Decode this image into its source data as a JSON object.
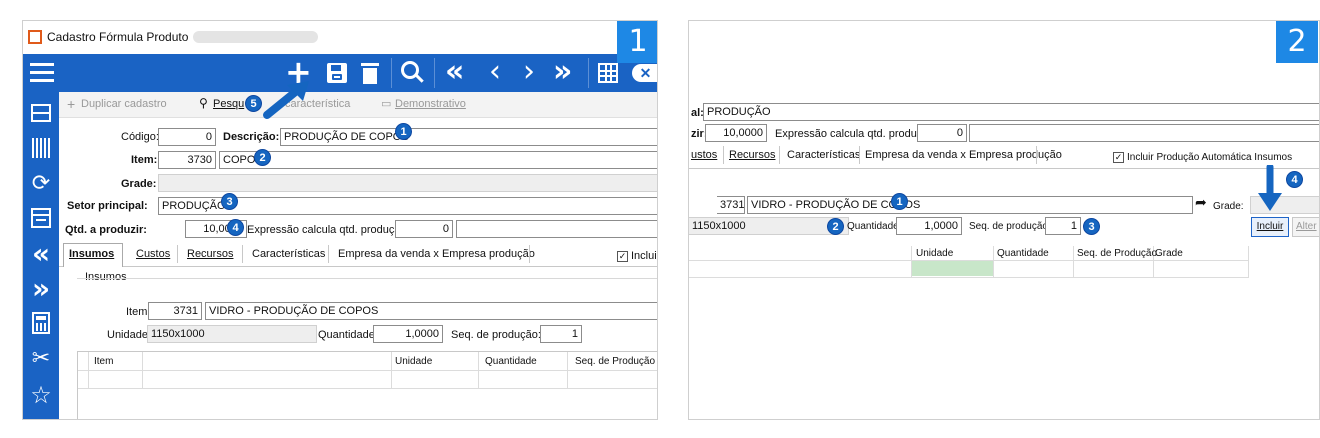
{
  "left": {
    "step": "1",
    "window_title": "Cadastro Fórmula Produto",
    "subtoolbar": {
      "duplicate": "Duplicar cadastro",
      "search": "Pesqu",
      "characteristic": "característica",
      "report": "Demonstrativo"
    },
    "form": {
      "codigo_label": "Código:",
      "codigo_value": "0",
      "descricao_label": "Descrição:",
      "descricao_value": "PRODUÇÃO DE COPOS",
      "item_label": "Item:",
      "item_code": "3730",
      "item_name": "COPO",
      "grade_label": "Grade:",
      "setor_label": "Setor principal:",
      "setor_value": "PRODUÇÃO",
      "qtd_label": "Qtd. a produzir:",
      "qtd_value": "10,0000",
      "expr_label": "Expressão calcula qtd. produção:",
      "expr_value": "0"
    },
    "tabs": [
      "Insumos",
      "Custos",
      "Recursos",
      "Características",
      "Empresa da venda x Empresa produção"
    ],
    "include_label": "Incluir",
    "insumos": {
      "group": "Insumos",
      "item_label": "Item:",
      "item_code": "3731",
      "item_name": "VIDRO - PRODUÇÃO DE COPOS",
      "unidade_label": "Unidade:",
      "unidade_value": "1150x1000",
      "quantidade_label": "Quantidade:",
      "quantidade_value": "1,0000",
      "seq_label": "Seq. de produção:",
      "seq_value": "1",
      "columns": [
        "Item",
        "Unidade",
        "Quantidade",
        "Seq. de Produção"
      ]
    },
    "badges": [
      "1",
      "2",
      "3",
      "4",
      "5"
    ]
  },
  "right": {
    "step": "2",
    "setor_label": "al:",
    "setor_value": "PRODUÇÃO",
    "qtd_label": "zir:",
    "qtd_value": "10,0000",
    "expr_label": "Expressão calcula qtd. produção:",
    "expr_value": "0",
    "tabs": [
      "ustos",
      "Recursos",
      "Características",
      "Empresa da venda x Empresa produção"
    ],
    "include_auto": "Incluir Produção Automática Insumos",
    "item_code": "3731",
    "item_name": "VIDRO - PRODUÇÃO DE COPOS",
    "grade_label": "Grade:",
    "unidade_value": "1150x1000",
    "quantidade_label": "Quantidade:",
    "quantidade_value": "1,0000",
    "seq_label": "Seq. de produção:",
    "seq_value": "1",
    "incluir_button": "Incluir",
    "alterar_button": "Alter",
    "columns": [
      "Unidade",
      "Quantidade",
      "Seq. de Produção",
      "Grade"
    ],
    "badges": [
      "1",
      "2",
      "3",
      "4"
    ]
  },
  "colors": {
    "toolbar": "#1a63c4",
    "sidebar": "#1a63c4",
    "accent_badge": "#1565c0",
    "step_box": "#1e88e5",
    "selected_cell": "#c8e6c9"
  }
}
